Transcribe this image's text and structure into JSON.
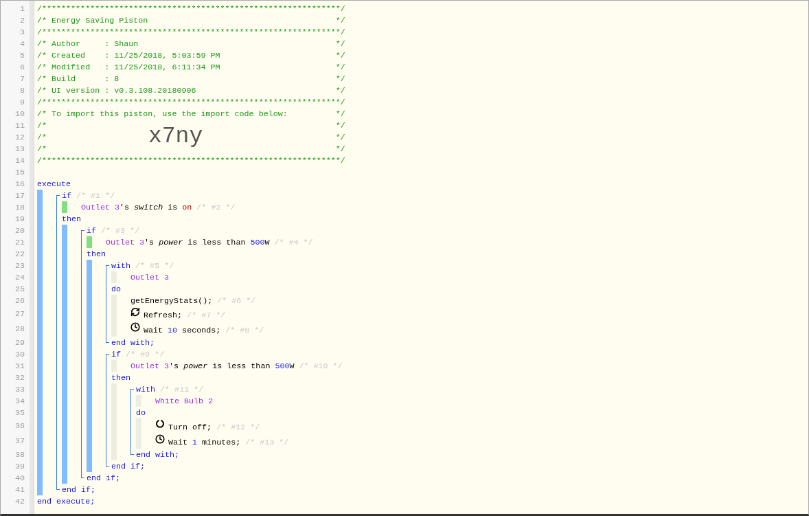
{
  "line_numbers": [
    "1",
    "2",
    "3",
    "4",
    "5",
    "6",
    "7",
    "8",
    "9",
    "10",
    "11",
    "12",
    "13",
    "14",
    "15",
    "16",
    "17",
    "18",
    "19",
    "20",
    "21",
    "22",
    "23",
    "24",
    "25",
    "26",
    "27",
    "28",
    "29",
    "30",
    "31",
    "32",
    "33",
    "34",
    "35",
    "36",
    "37",
    "38",
    "39",
    "40",
    "41",
    "42"
  ],
  "header": [
    {
      "kind": "rule",
      "text": "/**************************************************************/"
    },
    {
      "kind": "line",
      "text": "/* Energy Saving Piston",
      "end": "*/"
    },
    {
      "kind": "rule",
      "text": "/**************************************************************/"
    },
    {
      "kind": "line",
      "text": "/* Author     : Shaun",
      "end": "*/"
    },
    {
      "kind": "line",
      "text": "/* Created    : 11/25/2018, 5:03:59 PM",
      "end": "*/"
    },
    {
      "kind": "line",
      "text": "/* Modified   : 11/25/2018, 6:11:34 PM",
      "end": "*/"
    },
    {
      "kind": "line",
      "text": "/* Build      : 8",
      "end": "*/"
    },
    {
      "kind": "line",
      "text": "/* UI version : v0.3.108.20180906",
      "end": "*/"
    },
    {
      "kind": "rule",
      "text": "/**************************************************************/"
    },
    {
      "kind": "line",
      "text": "/* To import this piston, use the import code below:",
      "end": "*/"
    },
    {
      "kind": "line",
      "text": "/*",
      "end": "*/"
    },
    {
      "kind": "code",
      "text": "/*",
      "code": "x7ny",
      "end": "*/"
    },
    {
      "kind": "line",
      "text": "/*",
      "end": "*/"
    },
    {
      "kind": "rule",
      "text": "/**************************************************************/"
    },
    {
      "kind": "blank"
    }
  ],
  "program": {
    "open": [
      {
        "kind": "keyword",
        "text": "execute"
      }
    ],
    "executed": true,
    "close": [
      {
        "kind": "keyword",
        "text": "end execute;"
      }
    ],
    "body": [
      {
        "kind": "if",
        "head": [
          {
            "kind": "keyword",
            "text": "if"
          },
          {
            "kind": "comment",
            "text": " /* #1 */"
          }
        ],
        "conditions": [
          {
            "state": true,
            "tokens": [
              {
                "kind": "device",
                "text": "Outlet 3"
              },
              {
                "kind": "text",
                "text": "'s "
              },
              {
                "kind": "attribute",
                "text": "switch"
              },
              {
                "kind": "text",
                "text": " is "
              },
              {
                "kind": "value",
                "text": "on"
              },
              {
                "kind": "comment",
                "text": " /* #2 */"
              }
            ]
          }
        ],
        "then": [
          {
            "kind": "keyword",
            "text": "then"
          }
        ],
        "executed": true,
        "close": [
          {
            "kind": "keyword",
            "text": "end if;"
          }
        ],
        "body": [
          {
            "kind": "if",
            "head": [
              {
                "kind": "keyword",
                "text": "if"
              },
              {
                "kind": "comment",
                "text": " /* #3 */"
              }
            ],
            "conditions": [
              {
                "state": true,
                "tokens": [
                  {
                    "kind": "device",
                    "text": "Outlet 3"
                  },
                  {
                    "kind": "text",
                    "text": "'s "
                  },
                  {
                    "kind": "attribute",
                    "text": "power"
                  },
                  {
                    "kind": "text",
                    "text": " is less than "
                  },
                  {
                    "kind": "number",
                    "text": "500"
                  },
                  {
                    "kind": "text",
                    "text": "W"
                  },
                  {
                    "kind": "comment",
                    "text": " /* #4 */"
                  }
                ]
              }
            ],
            "then": [
              {
                "kind": "keyword",
                "text": "then"
              }
            ],
            "executed": true,
            "close": [
              {
                "kind": "keyword",
                "text": "end if;"
              }
            ],
            "body": [
              {
                "kind": "with",
                "head": [
                  {
                    "kind": "keyword",
                    "text": "with"
                  },
                  {
                    "kind": "comment",
                    "text": " /* #5 */"
                  }
                ],
                "devices": [
                  {
                    "tokens": [
                      {
                        "kind": "device",
                        "text": "Outlet 3"
                      }
                    ]
                  }
                ],
                "do": [
                  {
                    "kind": "keyword",
                    "text": "do"
                  }
                ],
                "close": [
                  {
                    "kind": "keyword",
                    "text": "end with;"
                  }
                ],
                "body": [
                  {
                    "kind": "command",
                    "tokens": [
                      {
                        "kind": "text",
                        "text": "getEnergyStats();"
                      },
                      {
                        "kind": "comment",
                        "text": " /* #6 */"
                      }
                    ]
                  },
                  {
                    "kind": "refresh",
                    "tokens": [
                      {
                        "kind": "text",
                        "text": "Refresh;"
                      },
                      {
                        "kind": "comment",
                        "text": " /* #7 */"
                      }
                    ]
                  },
                  {
                    "kind": "wait",
                    "tokens": [
                      {
                        "kind": "text",
                        "text": "Wait "
                      },
                      {
                        "kind": "number",
                        "text": "10"
                      },
                      {
                        "kind": "text",
                        "text": " seconds;"
                      },
                      {
                        "kind": "comment",
                        "text": " /* #8 */"
                      }
                    ]
                  }
                ]
              },
              {
                "kind": "if",
                "head": [
                  {
                    "kind": "keyword",
                    "text": "if"
                  },
                  {
                    "kind": "comment",
                    "text": " /* #9 */"
                  }
                ],
                "conditions": [
                  {
                    "state": false,
                    "tokens": [
                      {
                        "kind": "device",
                        "text": "Outlet 3"
                      },
                      {
                        "kind": "text",
                        "text": "'s "
                      },
                      {
                        "kind": "attribute",
                        "text": "power"
                      },
                      {
                        "kind": "text",
                        "text": " is less than "
                      },
                      {
                        "kind": "number",
                        "text": "500"
                      },
                      {
                        "kind": "text",
                        "text": "W"
                      },
                      {
                        "kind": "comment",
                        "text": " /* #10 */"
                      }
                    ]
                  }
                ],
                "then": [
                  {
                    "kind": "keyword",
                    "text": "then"
                  }
                ],
                "executed": false,
                "close": [
                  {
                    "kind": "keyword",
                    "text": "end if;"
                  }
                ],
                "body": [
                  {
                    "kind": "with",
                    "head": [
                      {
                        "kind": "keyword",
                        "text": "with"
                      },
                      {
                        "kind": "comment",
                        "text": " /* #11 */"
                      }
                    ],
                    "devices": [
                      {
                        "tokens": [
                          {
                            "kind": "device",
                            "text": "White Bulb 2"
                          }
                        ]
                      }
                    ],
                    "do": [
                      {
                        "kind": "keyword",
                        "text": "do"
                      }
                    ],
                    "close": [
                      {
                        "kind": "keyword",
                        "text": "end with;"
                      }
                    ],
                    "body": [
                      {
                        "kind": "turn_off",
                        "tokens": [
                          {
                            "kind": "text",
                            "text": "Turn off;"
                          },
                          {
                            "kind": "comment",
                            "text": " /* #12 */"
                          }
                        ]
                      },
                      {
                        "kind": "wait",
                        "tokens": [
                          {
                            "kind": "text",
                            "text": "Wait "
                          },
                          {
                            "kind": "number",
                            "text": "1"
                          },
                          {
                            "kind": "text",
                            "text": " minutes;"
                          },
                          {
                            "kind": "comment",
                            "text": " /* #13 */"
                          }
                        ]
                      }
                    ]
                  }
                ]
              }
            ]
          }
        ]
      }
    ]
  }
}
